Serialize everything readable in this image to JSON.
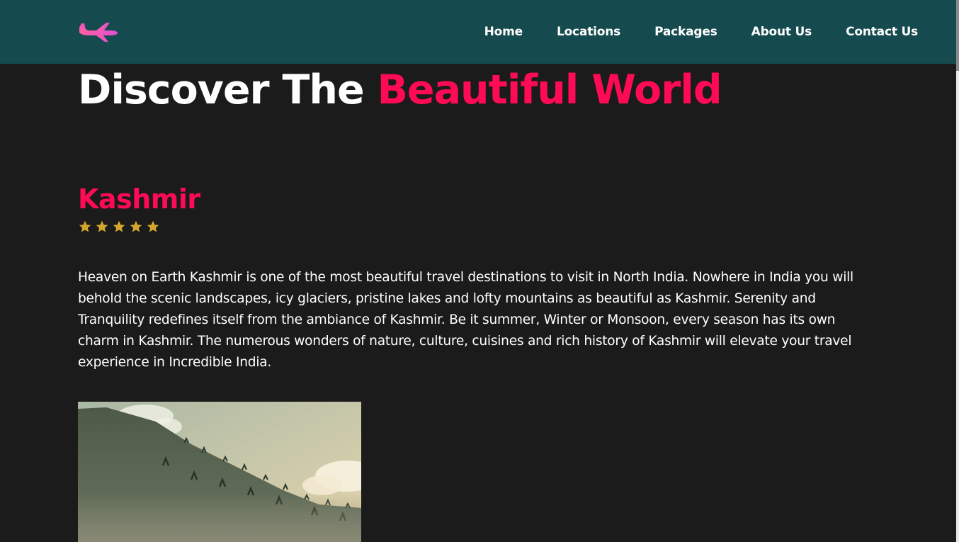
{
  "navbar": {
    "logo_icon": "airplane-icon",
    "background": "#154b4e",
    "links": [
      "Home",
      "Locations",
      "Packages",
      "About Us",
      "Contact Us"
    ]
  },
  "hero": {
    "title_prefix": "Discover The",
    "title_accent": "Beautiful World",
    "accent_color": "#ff0a54"
  },
  "destination": {
    "name": "Kashmir",
    "rating": 5,
    "max_rating": 5,
    "star_color": "#d4a72c",
    "description": "Heaven on Earth Kashmir is one of the most beautiful travel destinations to visit in North India. Nowhere in India you will behold the scenic landscapes, icy glaciers, pristine lakes and lofty mountains as beautiful as Kashmir. Serenity and Tranquility redefines itself from the ambiance of Kashmir. Be it summer, Winter or Monsoon, every season has its own charm in Kashmir. The numerous wonders of nature, culture, cuisines and rich history of Kashmir will elevate your travel experience in Incredible India."
  },
  "theme": {
    "page_background": "#1b1b1b",
    "text_color": "#ffffff"
  }
}
